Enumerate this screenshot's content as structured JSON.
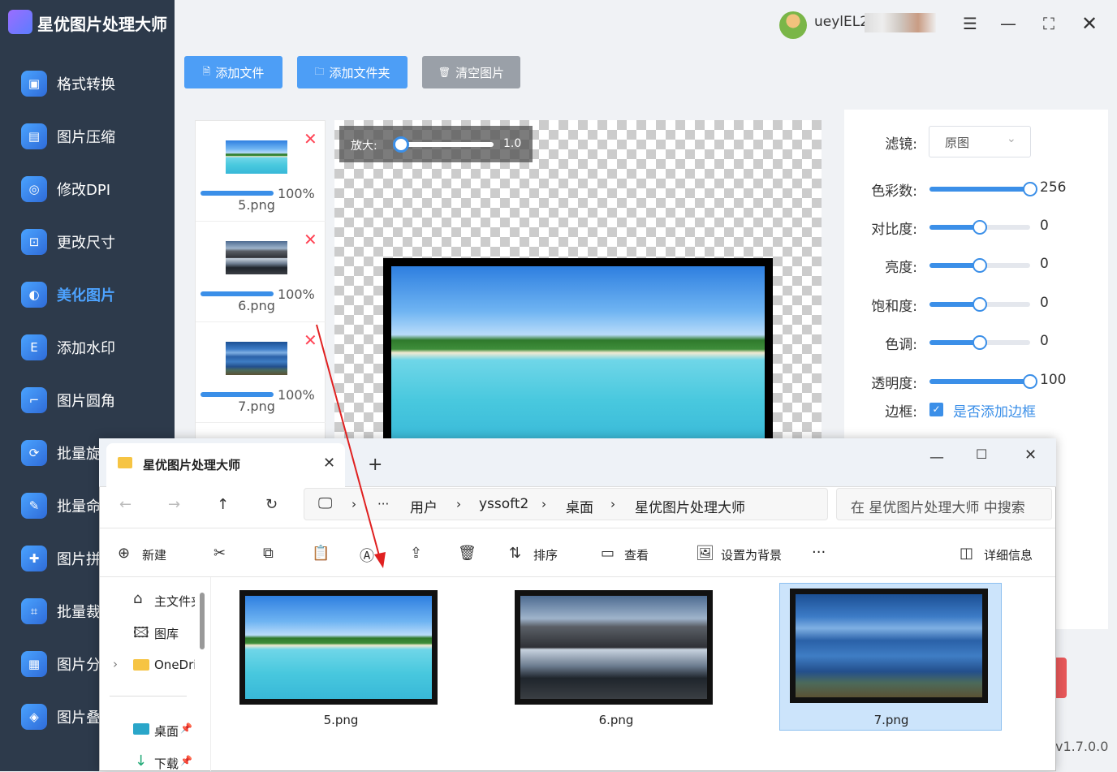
{
  "app": {
    "title": "星优图片处理大师",
    "version": "v1.7.0.0"
  },
  "sidebar": {
    "items": [
      {
        "label": "格式转换",
        "icon": "image-convert-icon"
      },
      {
        "label": "图片压缩",
        "icon": "compress-icon"
      },
      {
        "label": "修改DPI",
        "icon": "dpi-icon"
      },
      {
        "label": "更改尺寸",
        "icon": "resize-icon"
      },
      {
        "label": "美化图片",
        "icon": "beautify-icon",
        "active": true
      },
      {
        "label": "添加水印",
        "icon": "watermark-icon"
      },
      {
        "label": "图片圆角",
        "icon": "rounded-corner-icon"
      },
      {
        "label": "批量旋",
        "icon": "rotate-icon"
      },
      {
        "label": "批量命",
        "icon": "rename-icon"
      },
      {
        "label": "图片拼",
        "icon": "puzzle-icon"
      },
      {
        "label": "批量裁",
        "icon": "crop-icon"
      },
      {
        "label": "图片分",
        "icon": "split-icon"
      },
      {
        "label": "图片叠",
        "icon": "layers-icon"
      }
    ]
  },
  "user": {
    "name": "ueylEL2"
  },
  "toolbar": {
    "add_file": "添加文件",
    "add_folder": "添加文件夹",
    "clear": "清空图片"
  },
  "files": [
    {
      "name": "5.png",
      "progress": 1.0,
      "progress_text": "100%"
    },
    {
      "name": "6.png",
      "progress": 1.0,
      "progress_text": "100%"
    },
    {
      "name": "7.png",
      "progress": 1.0,
      "progress_text": "100%"
    }
  ],
  "preview": {
    "zoom_label": "放大:",
    "zoom_value": "1.0",
    "zoom_level": 0.0
  },
  "settings": {
    "filter_label": "滤镜:",
    "filter_value": "原图",
    "sliders": [
      {
        "label": "色彩数:",
        "value": "256",
        "level": 1.0
      },
      {
        "label": "对比度:",
        "value": "0",
        "level": 0.5
      },
      {
        "label": "亮度:",
        "value": "0",
        "level": 0.5
      },
      {
        "label": "饱和度:",
        "value": "0",
        "level": 0.5
      },
      {
        "label": "色调:",
        "value": "0",
        "level": 0.5
      },
      {
        "label": "透明度:",
        "value": "100",
        "level": 1.0
      }
    ],
    "border_label": "边框:",
    "border_checkbox_label": "是否添加边框",
    "border_checked": true
  },
  "explorer": {
    "tab_title": "星优图片处理大师",
    "breadcrumb": [
      "用户",
      "yssoft2",
      "桌面",
      "星优图片处理大师"
    ],
    "search_placeholder": "在 星优图片处理大师 中搜索",
    "commands": {
      "new": "新建",
      "sort": "排序",
      "view": "查看",
      "set_bg": "设置为背景",
      "details": "详细信息"
    },
    "nav": [
      "主文件夹",
      "图库",
      "OneDri",
      "桌面",
      "下载"
    ],
    "files": [
      "5.png",
      "6.png",
      "7.png"
    ]
  }
}
